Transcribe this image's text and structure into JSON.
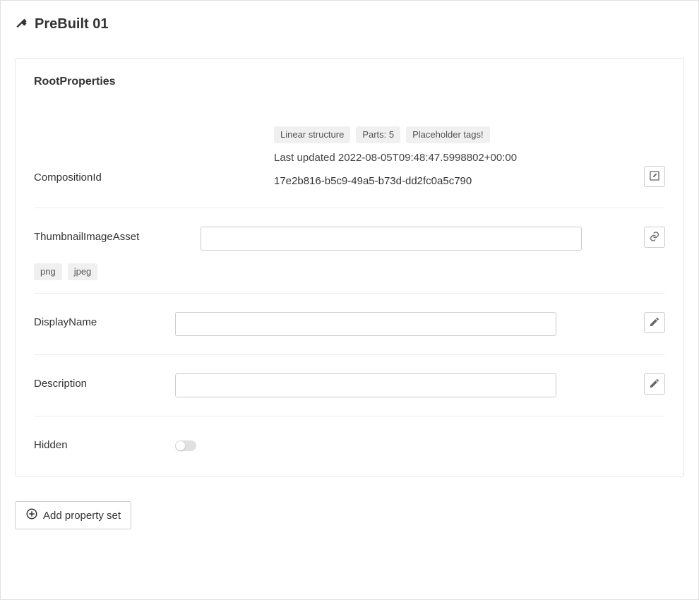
{
  "header": {
    "title": "PreBuilt 01"
  },
  "card": {
    "title": "RootProperties",
    "composition": {
      "label": "CompositionId",
      "tags": [
        "Linear structure",
        "Parts: 5",
        "Placeholder tags!"
      ],
      "last_updated_prefix": "Last updated ",
      "last_updated": "2022-08-05T09:48:47.5998802+00:00",
      "id_value": "17e2b816-b5c9-49a5-b73d-dd2fc0a5c790"
    },
    "thumbnail": {
      "label": "ThumbnailImageAsset",
      "value": "",
      "tags": [
        "png",
        "jpeg"
      ]
    },
    "display_name": {
      "label": "DisplayName",
      "value": ""
    },
    "description": {
      "label": "Description",
      "value": ""
    },
    "hidden": {
      "label": "Hidden",
      "value": false
    }
  },
  "actions": {
    "add_property_set": "Add property set"
  }
}
